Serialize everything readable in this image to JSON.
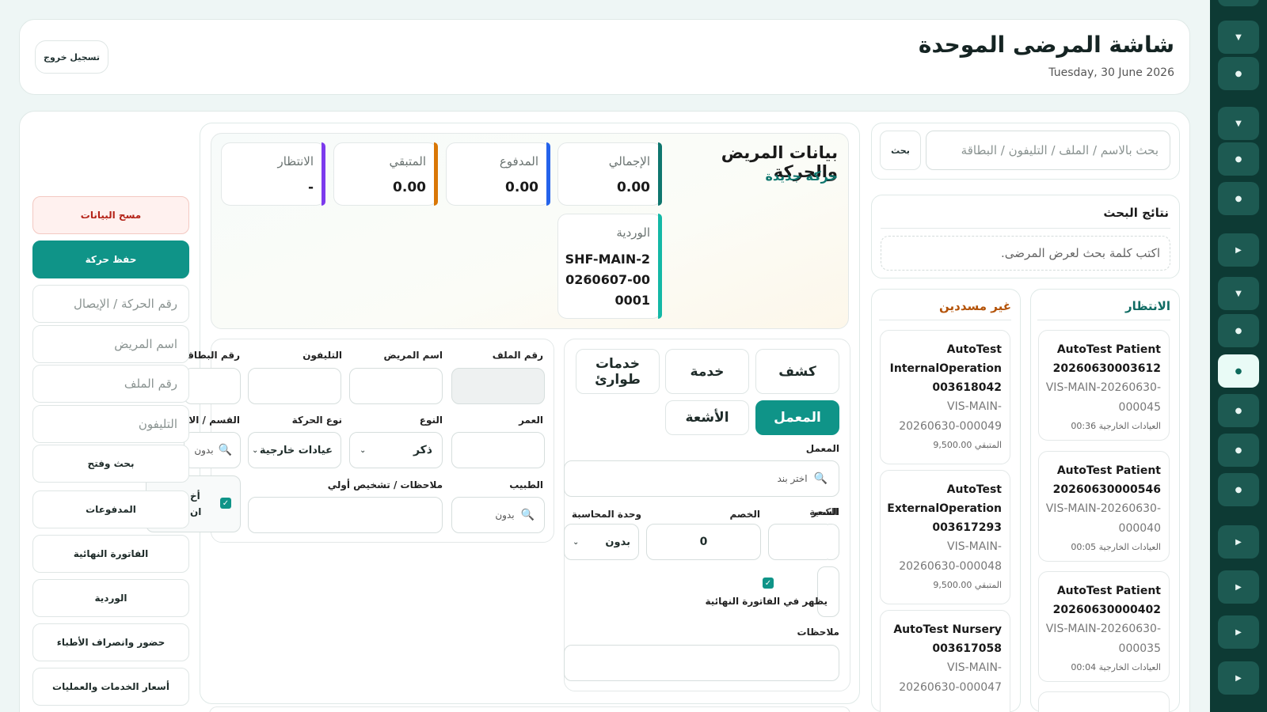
{
  "header": {
    "title": "شاشة المرضى الموحدة",
    "date": "Tuesday, 30 June 2026",
    "logout_label": "تسجيل خروج"
  },
  "search": {
    "placeholder": "بحث بالاسم / الملف / التليفون / البطاقة",
    "button_label": "بحث",
    "results_title": "نتائج البحث",
    "results_empty": "اكتب كلمة بحث لعرض المرضى."
  },
  "queue": {
    "title": "الانتظار",
    "items": [
      {
        "name": "AutoTest Patient 20260630003612",
        "code": "VIS-MAIN-20260630-000045",
        "sub": "العيادات الخارجية 00:36"
      },
      {
        "name": "AutoTest Patient 20260630000546",
        "code": "VIS-MAIN-20260630-000040",
        "sub": "العيادات الخارجية 00:05"
      },
      {
        "name": "AutoTest Patient 20260630000402",
        "code": "VIS-MAIN-20260630-000035",
        "sub": "العيادات الخارجية 00:04"
      }
    ]
  },
  "unpaid": {
    "title": "غير مسددين",
    "items": [
      {
        "name": "AutoTest InternalOperation 003618042",
        "code": "VIS-MAIN-20260630-000049",
        "sub": "المتبقي 9,500.00"
      },
      {
        "name": "AutoTest ExternalOperation 003617293",
        "code": "VIS-MAIN-20260630-000048",
        "sub": "المتبقي 9,500.00"
      },
      {
        "name": "AutoTest Nursery 003617058",
        "code": "VIS-MAIN-20260630-000047",
        "sub": ""
      }
    ]
  },
  "patient": {
    "title": "بيانات المريض والحركة",
    "subtitle": "حركة جديدة",
    "stats": [
      {
        "label": "الإجمالي",
        "value": "0.00",
        "color": "#0f766e"
      },
      {
        "label": "المدفوع",
        "value": "0.00",
        "color": "#2563eb"
      },
      {
        "label": "المتبقي",
        "value": "0.00",
        "color": "#d97706"
      },
      {
        "label": "الانتظار",
        "value": "-",
        "color": "#7c3aed"
      }
    ],
    "shift": {
      "label": "الوردية",
      "value": "SHF-MAIN-20260607-000001"
    }
  },
  "services": {
    "tabs": [
      "كشف",
      "خدمة",
      "خدمات طوارئ",
      "المعمل",
      "الأشعة"
    ],
    "active_tab": "المعمل",
    "item_label": "المعمل",
    "item_placeholder": "اختر بند",
    "price_label": "السعر",
    "price_overlap_label": "الكمية",
    "discount_label": "الخصم",
    "discount_value": "0",
    "account_unit_label": "وحدة المحاسبة",
    "account_unit_value": "بدون",
    "show_in_invoice_label": "يظهر في الفاتورة النهائية",
    "notes_label": "ملاحظات"
  },
  "form": {
    "file_no_label": "رقم الملف",
    "patient_name_label": "اسم المريض",
    "phone_label": "التليفون",
    "card_no_label": "رقم البطاقة",
    "age_label": "العمر",
    "gender_label": "النوع",
    "gender_value": "ذكر",
    "movement_type_label": "نوع الحركة",
    "movement_type_value": "عيادات خارجية",
    "dept_label": "القسم / الا",
    "dept_value": "بدون",
    "doctor_label": "الطبيب",
    "doctor_value": "بدون",
    "notes_label": "ملاحظات / تشخيص أولي",
    "checkbox_text_1": "أخ",
    "checkbox_text_2": "ان"
  },
  "sidebar": {
    "clear_label": "مسح البيانات",
    "save_label": "حفظ حركة",
    "movement_no_placeholder": "رقم الحركة / الإيصال",
    "patient_name_placeholder": "اسم المريض",
    "file_no_placeholder": "رقم الملف",
    "phone_placeholder": "التليفون",
    "items": [
      "بحث وفتح",
      "المدفوعات",
      "الفاتورة النهائية",
      "الوردية",
      "حضور وانصراف الأطباء",
      "أسعار الخدمات والعمليات"
    ]
  },
  "colors": {
    "primary": "#0f9488",
    "danger_text": "#b42318",
    "danger_bg": "#fff1ef",
    "accent_gold": "#b45309",
    "rail": "#0d3a34"
  },
  "icons": {
    "search": "magnifier-icon",
    "rail": [
      "chevron-down-icon",
      "dot-icon",
      "play-icon"
    ]
  }
}
